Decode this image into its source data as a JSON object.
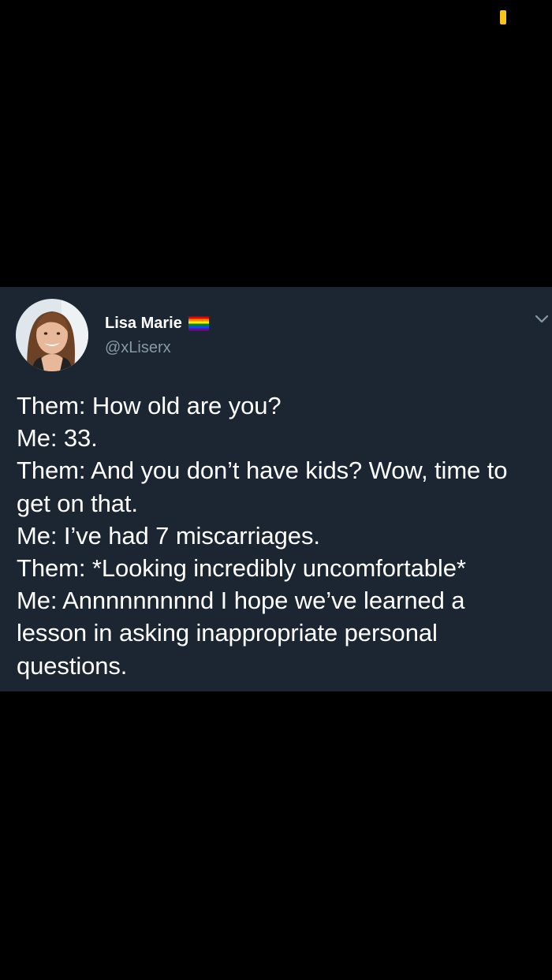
{
  "colors": {
    "page_background": "#000000",
    "card_background": "#1c2633",
    "primary_text": "#ffffff",
    "secondary_text": "#8899a6",
    "status_indicator": "#f5c518"
  },
  "tweet": {
    "author": {
      "display_name": "Lisa Marie",
      "handle": "@xLiserx",
      "name_badge_icon": "rainbow-flag-icon",
      "avatar_icon": "profile-photo"
    },
    "menu_icon": "chevron-down-icon",
    "text": "Them: How old are you?\nMe: 33.\nThem: And you don’t have kids? Wow, time to get on that.\nMe: I’ve had 7 miscarriages.\nThem: *Looking incredibly uncomfortable*\nMe: Annnnnnnnnd I hope we’ve learned a lesson in asking inappropriate personal questions."
  }
}
